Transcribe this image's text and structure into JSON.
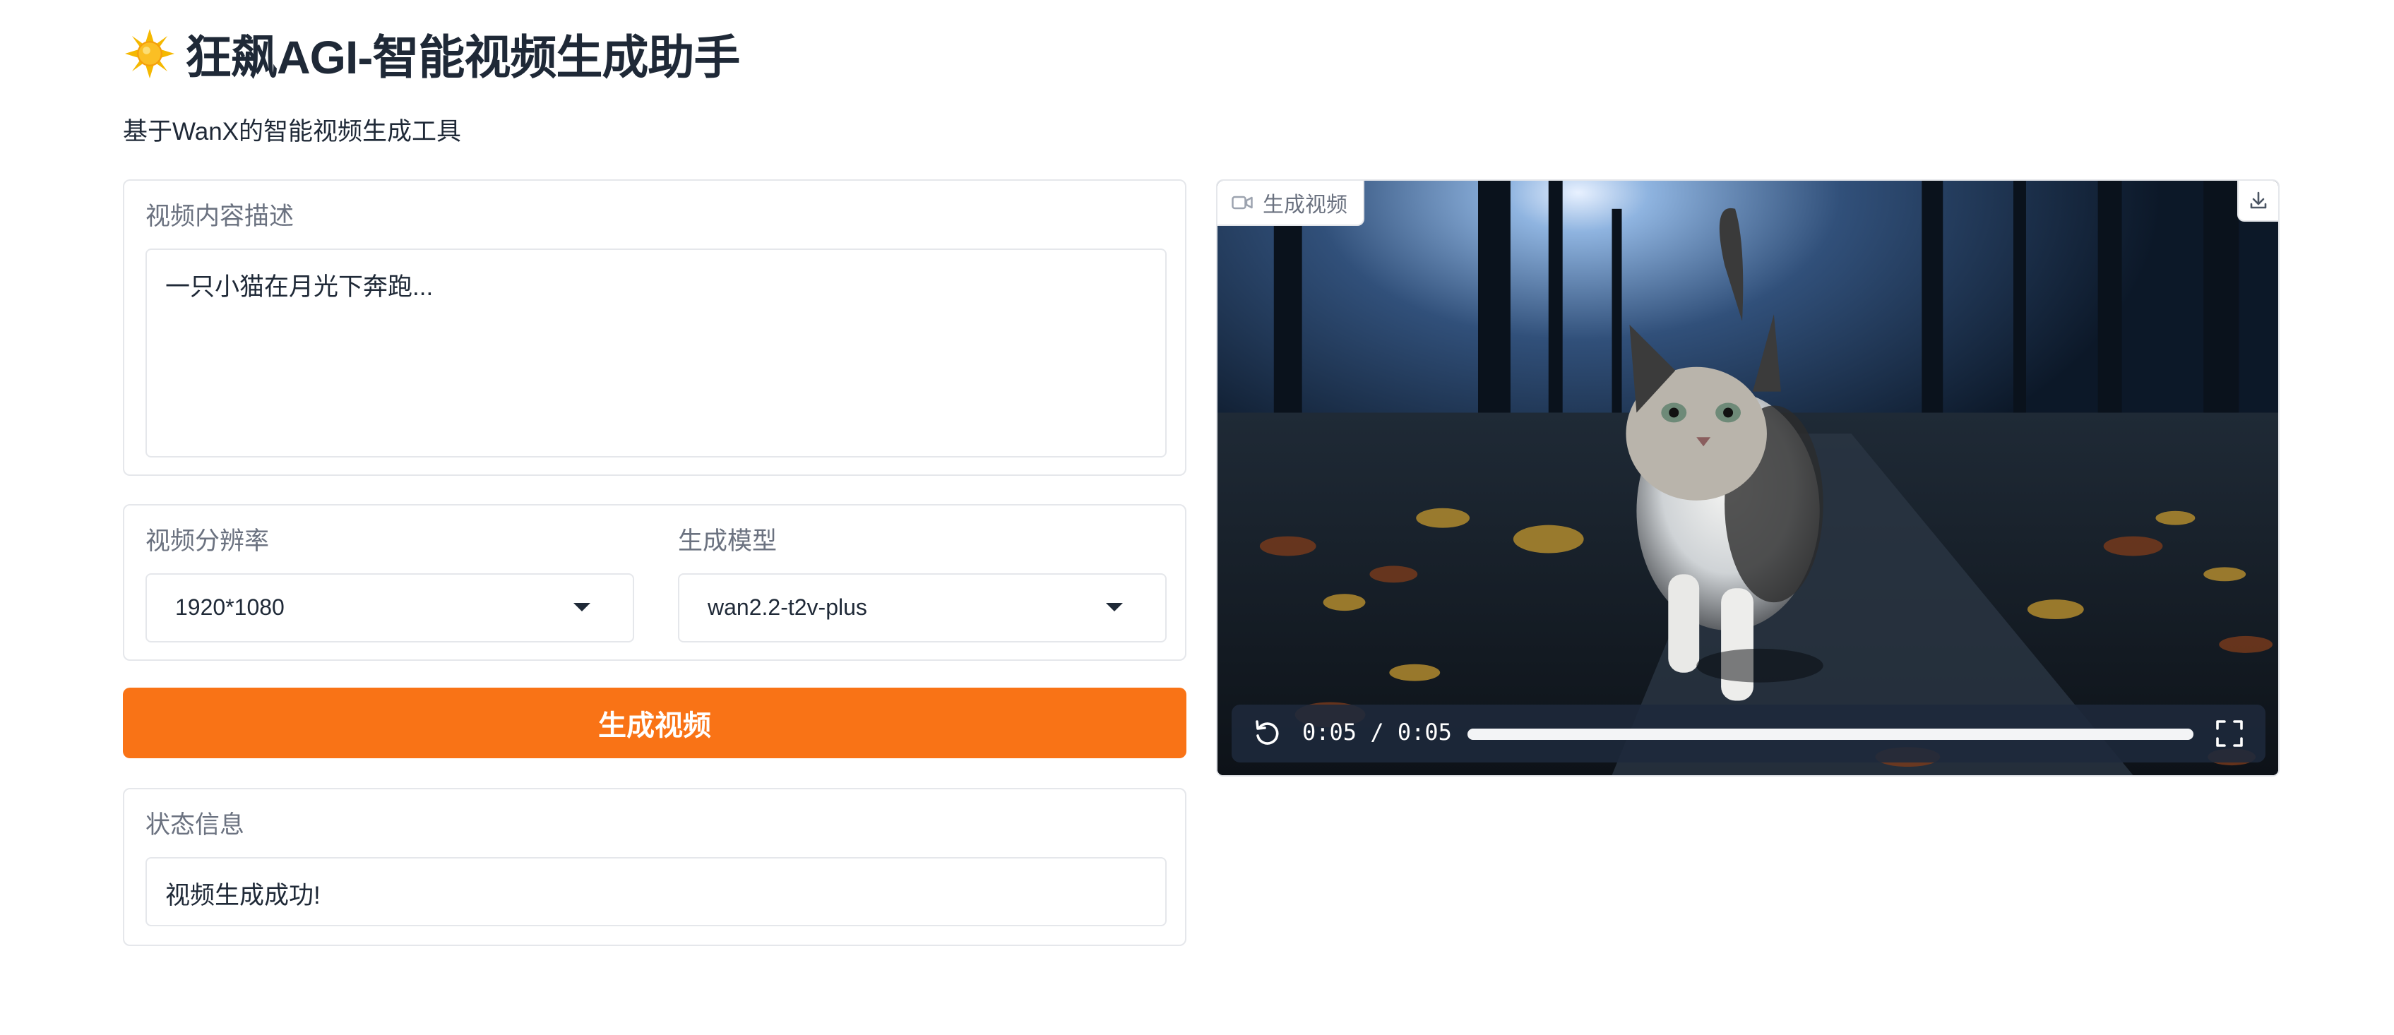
{
  "header": {
    "title": "狂飙AGI-智能视频生成助手",
    "subtitle": "基于WanX的智能视频生成工具",
    "icon": "sun-icon"
  },
  "prompt_panel": {
    "label": "视频内容描述",
    "value": "一只小猫在月光下奔跑..."
  },
  "options_panel": {
    "resolution": {
      "label": "视频分辨率",
      "value": "1920*1080"
    },
    "model": {
      "label": "生成模型",
      "value": "wan2.2-t2v-plus"
    }
  },
  "generate_button": {
    "label": "生成视频"
  },
  "status_panel": {
    "label": "状态信息",
    "value": "视频生成成功!"
  },
  "video_panel": {
    "badge": "生成视频",
    "time": "0:05 / 0:05",
    "progress": 1.0,
    "icons": [
      "video-camera-icon",
      "download-icon",
      "replay-icon",
      "fullscreen-icon"
    ]
  },
  "colors": {
    "accent": "#f97316",
    "border": "#e5e7eb",
    "label": "#6b7280",
    "text": "#1f2937"
  }
}
